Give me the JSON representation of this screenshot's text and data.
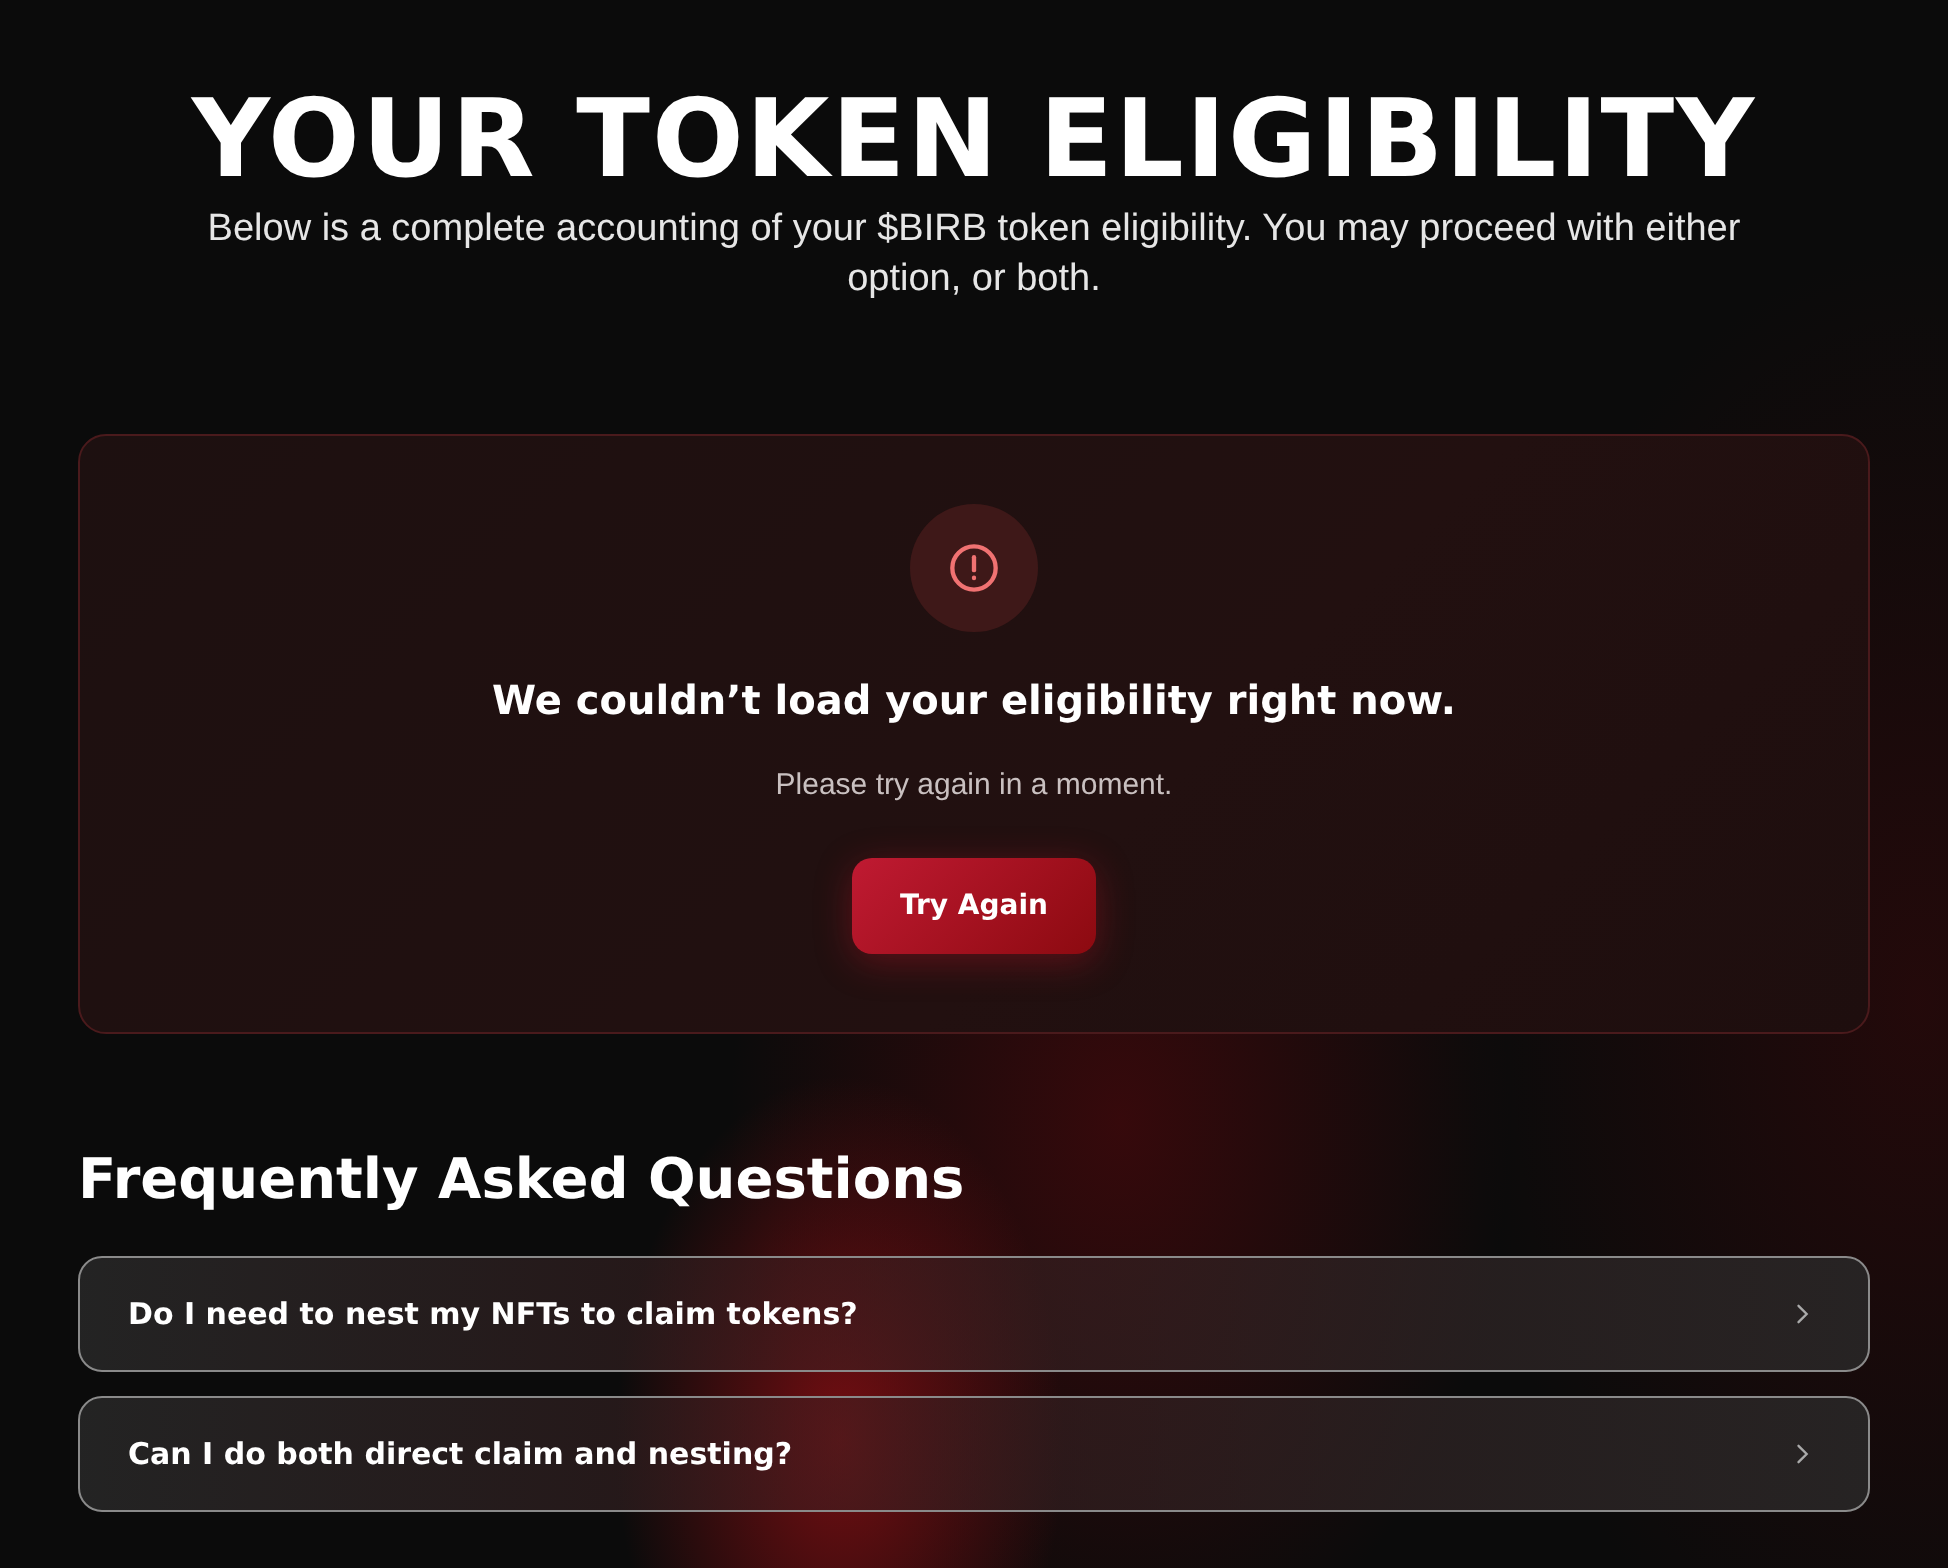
{
  "header": {
    "title": "YOUR TOKEN ELIGIBILITY",
    "subtitle": "Below is a complete accounting of your $BIRB token eligibility. You may proceed with either option, or both."
  },
  "error_card": {
    "message": "We couldn’t load your eligibility right now.",
    "hint": "Please try again in a moment.",
    "button": "Try Again"
  },
  "faq": {
    "title": "Frequently Asked Questions",
    "items": [
      {
        "question": "Do I need to nest my NFTs to claim tokens?",
        "expanded": false
      },
      {
        "question": "Can I do both direct claim and nesting?",
        "expanded": false
      }
    ]
  }
}
